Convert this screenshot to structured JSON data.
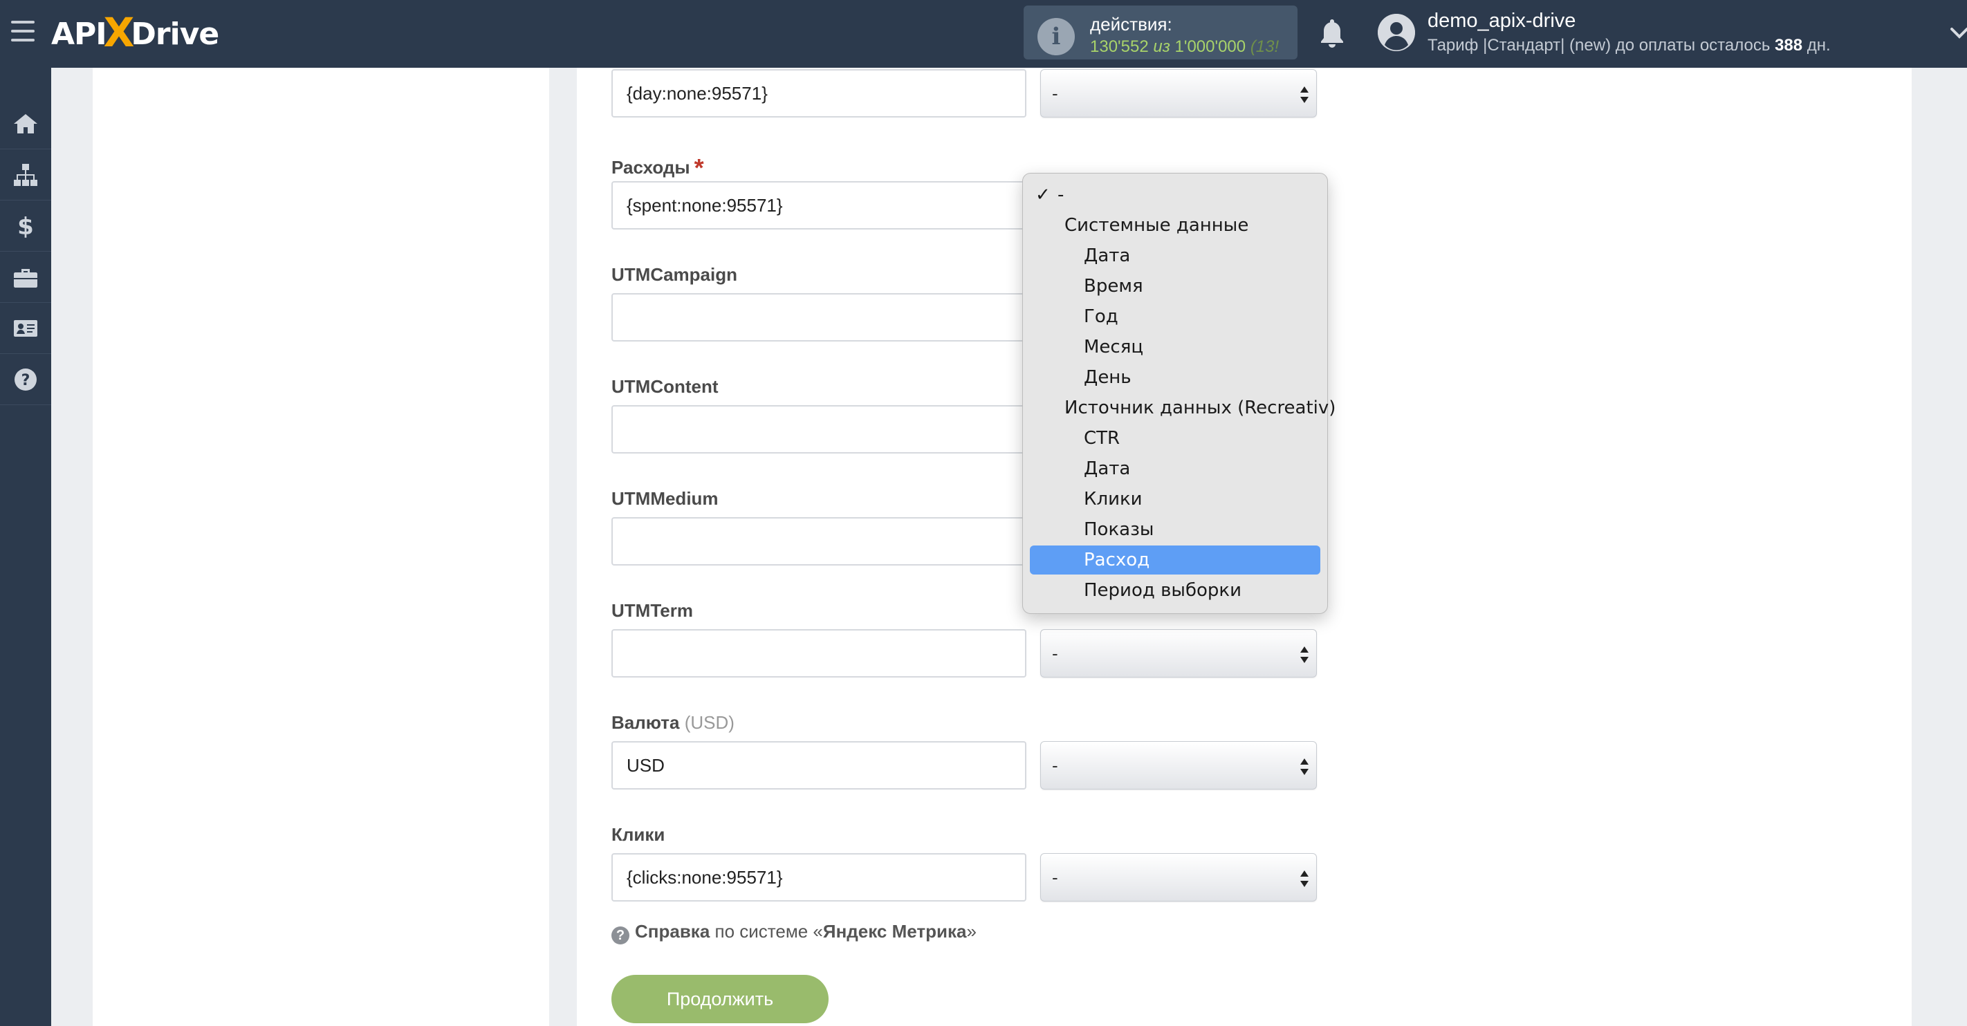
{
  "header": {
    "logo_left": "API",
    "logo_x": "X",
    "logo_right": "Drive",
    "actions_label": "действия:",
    "actions_used": "130'552",
    "actions_of": "из",
    "actions_total": "1'000'000",
    "actions_extra": "(13!",
    "user_name": "demo_apix-drive",
    "plan_prefix": "Тариф |Стандарт| (new) до оплаты осталось",
    "plan_days": "388",
    "plan_suffix": "дн."
  },
  "sidebar": {
    "items": [
      "home-icon",
      "sitemap-icon",
      "dollar-icon",
      "briefcase-icon",
      "id-card-icon",
      "question-icon"
    ]
  },
  "form": {
    "day_value": "{day:none:95571}",
    "spent_label": "Расходы",
    "spent_required": "*",
    "spent_value": "{spent:none:95571}",
    "utm_campaign_label": "UTMCampaign",
    "utm_content_label": "UTMContent",
    "utm_medium_label": "UTMMedium",
    "utm_term_label": "UTMTerm",
    "currency_label": "Валюта",
    "currency_hint": "(USD)",
    "currency_value": "USD",
    "clicks_label": "Клики",
    "clicks_value": "{clicks:none:95571}",
    "select_default": "-",
    "help_prefix": "Справка",
    "help_middle": "по системе «",
    "help_system": "Яндекс Метрика",
    "help_suffix": "»",
    "continue_label": "Продолжить"
  },
  "dropdown": {
    "items": [
      {
        "label": "-",
        "indent": 0,
        "checked": true,
        "selected": false
      },
      {
        "label": "Системные данные",
        "indent": 1,
        "checked": false,
        "selected": false
      },
      {
        "label": "Дата",
        "indent": 2,
        "checked": false,
        "selected": false
      },
      {
        "label": "Время",
        "indent": 2,
        "checked": false,
        "selected": false
      },
      {
        "label": "Год",
        "indent": 2,
        "checked": false,
        "selected": false
      },
      {
        "label": "Месяц",
        "indent": 2,
        "checked": false,
        "selected": false
      },
      {
        "label": "День",
        "indent": 2,
        "checked": false,
        "selected": false
      },
      {
        "label": "Источник данных (Recreativ)",
        "indent": 1,
        "checked": false,
        "selected": false
      },
      {
        "label": "CTR",
        "indent": 2,
        "checked": false,
        "selected": false
      },
      {
        "label": "Дата",
        "indent": 2,
        "checked": false,
        "selected": false
      },
      {
        "label": "Клики",
        "indent": 2,
        "checked": false,
        "selected": false
      },
      {
        "label": "Показы",
        "indent": 2,
        "checked": false,
        "selected": false
      },
      {
        "label": "Расход",
        "indent": 2,
        "checked": false,
        "selected": true
      },
      {
        "label": "Период выборки",
        "indent": 2,
        "checked": false,
        "selected": false
      }
    ],
    "check_glyph": "✓"
  },
  "colors": {
    "topbar": "#2c3a4d",
    "accent_green": "#99bb6c",
    "logo_x": "#f7a600",
    "dropdown_selected": "#5e9ef5"
  }
}
